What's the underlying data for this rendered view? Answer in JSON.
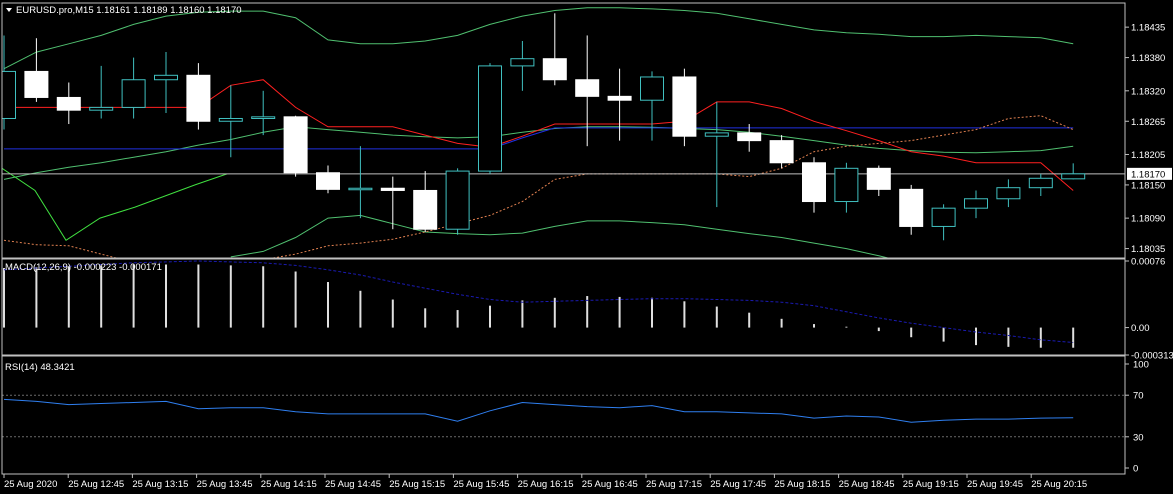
{
  "header": {
    "symbol_line": "EURUSD.pro,M15  1.18161 1.18189 1.18160 1.18170",
    "macd_label": "MACD(12,26,9) -0.000223 -0.000171",
    "rsi_label": "RSI(14) 48.3421"
  },
  "colors": {
    "background": "#000000",
    "frame": "#c0c0c0",
    "bull_body": "#000000",
    "bull_border": "#40c0c0",
    "bear_body": "#ffffff",
    "bear_border": "#ffffff",
    "bollinger": "#50c070",
    "envelope_lime": "#40e040",
    "tenkan_red": "#ff2020",
    "kijun_blue": "#2030e0",
    "chikou_dotted": "#e08050",
    "macd_hist": "#e0e0e0",
    "macd_signal": "#1a1ab0",
    "rsi_line": "#2f7ff0",
    "grid": "#6a6a6a",
    "price_marker_line": "#c0c0c0"
  },
  "chart_data": [
    {
      "type": "candlestick",
      "title": "EURUSD.pro,M15",
      "ylim": [
        1.18018,
        1.18475
      ],
      "y_ticks": [
        "1.18435",
        "1.18380",
        "1.18320",
        "1.18265",
        "1.18205",
        "1.18150",
        "1.18090",
        "1.18035"
      ],
      "current_price": "1.18170",
      "candles": [
        {
          "o": 1.1827,
          "h": 1.1842,
          "l": 1.1825,
          "c": 1.18355
        },
        {
          "o": 1.18355,
          "h": 1.18415,
          "l": 1.183,
          "c": 1.18308
        },
        {
          "o": 1.18308,
          "h": 1.18335,
          "l": 1.1826,
          "c": 1.18285
        },
        {
          "o": 1.18285,
          "h": 1.18365,
          "l": 1.1827,
          "c": 1.1829
        },
        {
          "o": 1.1829,
          "h": 1.1838,
          "l": 1.1827,
          "c": 1.1834
        },
        {
          "o": 1.1834,
          "h": 1.1839,
          "l": 1.1828,
          "c": 1.18348
        },
        {
          "o": 1.18348,
          "h": 1.1837,
          "l": 1.1825,
          "c": 1.18265
        },
        {
          "o": 1.18265,
          "h": 1.1833,
          "l": 1.182,
          "c": 1.1827
        },
        {
          "o": 1.1827,
          "h": 1.1832,
          "l": 1.1824,
          "c": 1.18273
        },
        {
          "o": 1.18273,
          "h": 1.18275,
          "l": 1.18165,
          "c": 1.18172
        },
        {
          "o": 1.18172,
          "h": 1.18185,
          "l": 1.18135,
          "c": 1.18142
        },
        {
          "o": 1.18142,
          "h": 1.1822,
          "l": 1.1809,
          "c": 1.18144
        },
        {
          "o": 1.18144,
          "h": 1.18165,
          "l": 1.1807,
          "c": 1.1814
        },
        {
          "o": 1.1814,
          "h": 1.18175,
          "l": 1.18065,
          "c": 1.1807
        },
        {
          "o": 1.1807,
          "h": 1.1818,
          "l": 1.1806,
          "c": 1.18175
        },
        {
          "o": 1.18175,
          "h": 1.1837,
          "l": 1.1817,
          "c": 1.18365
        },
        {
          "o": 1.18365,
          "h": 1.1841,
          "l": 1.1832,
          "c": 1.18378
        },
        {
          "o": 1.18378,
          "h": 1.1846,
          "l": 1.1833,
          "c": 1.1834
        },
        {
          "o": 1.1834,
          "h": 1.1842,
          "l": 1.1822,
          "c": 1.1831
        },
        {
          "o": 1.1831,
          "h": 1.1836,
          "l": 1.1823,
          "c": 1.18303
        },
        {
          "o": 1.18303,
          "h": 1.18355,
          "l": 1.1823,
          "c": 1.18345
        },
        {
          "o": 1.18345,
          "h": 1.1836,
          "l": 1.1822,
          "c": 1.18238
        },
        {
          "o": 1.18238,
          "h": 1.183,
          "l": 1.1811,
          "c": 1.18244
        },
        {
          "o": 1.18244,
          "h": 1.1826,
          "l": 1.1821,
          "c": 1.1823
        },
        {
          "o": 1.1823,
          "h": 1.1824,
          "l": 1.1818,
          "c": 1.1819
        },
        {
          "o": 1.1819,
          "h": 1.182,
          "l": 1.181,
          "c": 1.1812
        },
        {
          "o": 1.1812,
          "h": 1.1819,
          "l": 1.181,
          "c": 1.1818
        },
        {
          "o": 1.1818,
          "h": 1.18185,
          "l": 1.1813,
          "c": 1.18142
        },
        {
          "o": 1.18142,
          "h": 1.1815,
          "l": 1.1806,
          "c": 1.18075
        },
        {
          "o": 1.18075,
          "h": 1.18115,
          "l": 1.1805,
          "c": 1.18108
        },
        {
          "o": 1.18108,
          "h": 1.1814,
          "l": 1.1809,
          "c": 1.18125
        },
        {
          "o": 1.18125,
          "h": 1.1816,
          "l": 1.1811,
          "c": 1.18145
        },
        {
          "o": 1.18145,
          "h": 1.1817,
          "l": 1.1813,
          "c": 1.18162
        },
        {
          "o": 1.18161,
          "h": 1.18189,
          "l": 1.1816,
          "c": 1.1817
        }
      ],
      "overlays": {
        "bollinger_upper": [
          1.1836,
          1.1839,
          1.18405,
          1.1842,
          1.1844,
          1.18455,
          1.18462,
          1.18464,
          1.18464,
          1.18452,
          1.18412,
          1.18405,
          1.18405,
          1.1841,
          1.1842,
          1.1844,
          1.18455,
          1.18465,
          1.1847,
          1.1847,
          1.18468,
          1.18465,
          1.1846,
          1.1845,
          1.1844,
          1.1843,
          1.18425,
          1.18422,
          1.18418,
          1.18418,
          1.1842,
          1.18418,
          1.18416,
          1.18405
        ],
        "bollinger_middle": [
          1.1816,
          1.18172,
          1.18182,
          1.1819,
          1.182,
          1.1821,
          1.18222,
          1.18232,
          1.18245,
          1.18255,
          1.1825,
          1.18245,
          1.1824,
          1.18237,
          1.18235,
          1.18237,
          1.18245,
          1.18252,
          1.18255,
          1.18255,
          1.18254,
          1.18252,
          1.1825,
          1.18245,
          1.18238,
          1.1823,
          1.18222,
          1.18216,
          1.18212,
          1.18209,
          1.18208,
          1.1821,
          1.18212,
          1.1822
        ],
        "bollinger_lower": [
          null,
          null,
          null,
          null,
          null,
          null,
          null,
          1.1802,
          1.1803,
          1.18055,
          1.1809,
          1.18095,
          1.1808,
          1.18065,
          1.18062,
          1.1806,
          1.18063,
          1.18075,
          1.18085,
          1.18085,
          1.18082,
          1.18078,
          1.1807,
          1.18062,
          1.18055,
          1.18045,
          1.18035,
          1.18022,
          1.18008,
          null,
          null,
          null,
          null,
          null
        ],
        "envelope_lime": [
          1.1818,
          1.1814,
          1.1805,
          1.1809,
          1.1811,
          1.1813,
          1.1815,
          1.1817
        ],
        "tenkan_red": [
          1.1829,
          1.1829,
          1.1829,
          1.1829,
          1.1829,
          1.1829,
          1.1829,
          1.1833,
          1.1834,
          1.1829,
          1.18255,
          1.18255,
          1.18255,
          1.1824,
          1.18225,
          1.18218,
          1.18238,
          1.1826,
          1.1826,
          1.1826,
          1.1826,
          1.18265,
          1.183,
          1.183,
          1.18288,
          1.18265,
          1.18248,
          1.1823,
          1.1821,
          1.18202,
          1.1819,
          1.1819,
          1.1819,
          1.1814
        ],
        "kijun_blue": [
          1.18215,
          1.18215,
          1.18215,
          1.18215,
          1.18215,
          1.18215,
          1.18215,
          1.18215,
          1.18215,
          1.18215,
          1.18215,
          1.18215,
          1.18215,
          1.18215,
          1.18215,
          1.18215,
          1.18235,
          1.18253,
          1.18253,
          1.18253,
          1.18253,
          1.18253,
          1.18253,
          1.18253,
          1.18253,
          1.18253,
          1.18253,
          1.18253,
          1.18253,
          1.18253,
          1.18253,
          1.18253,
          1.18253,
          1.18253
        ],
        "chikou_dotted": [
          1.1805,
          1.18042,
          1.1804,
          1.18025,
          1.1801,
          1.18005,
          1.1801,
          1.18015,
          1.18015,
          1.18025,
          1.1804,
          1.18045,
          1.18052,
          1.18065,
          1.1808,
          1.18095,
          1.1812,
          1.1816,
          1.1817,
          1.1817,
          1.1817,
          1.1817,
          1.1817,
          1.18165,
          1.1818,
          1.1821,
          1.1822,
          1.18225,
          1.1823,
          1.1824,
          1.1825,
          1.1827,
          1.18275,
          1.1825
        ]
      }
    },
    {
      "type": "bar",
      "title": "MACD(12,26,9)",
      "ylim": [
        -0.000313,
        0.00076
      ],
      "y_ticks": [
        "0.00076",
        "0.00",
        "-0.000313"
      ],
      "histogram": [
        0.00068,
        0.00069,
        0.0007,
        0.00071,
        0.00072,
        0.00072,
        0.00072,
        0.00071,
        0.0007,
        0.00064,
        0.00052,
        0.00042,
        0.00032,
        0.00022,
        0.0002,
        0.00025,
        0.00031,
        0.00034,
        0.00036,
        0.00035,
        0.00034,
        0.0003,
        0.00024,
        0.00017,
        0.0001,
        4e-05,
        1e-05,
        -4e-05,
        -0.00011,
        -0.00016,
        -0.0002,
        -0.00022,
        -0.00023,
        -0.00023
      ],
      "signal": [
        0.00066,
        0.00068,
        0.0007,
        0.00072,
        0.00074,
        0.00075,
        0.00076,
        0.00075,
        0.00074,
        0.00071,
        0.00066,
        0.0006,
        0.00052,
        0.00045,
        0.00038,
        0.00032,
        0.00029,
        0.0003,
        0.00031,
        0.00032,
        0.00033,
        0.00033,
        0.00032,
        0.00031,
        0.00029,
        0.00025,
        0.00018,
        0.00011,
        5e-05,
        0.0,
        -5e-05,
        -9e-05,
        -0.00014,
        -0.00017
      ]
    },
    {
      "type": "line",
      "title": "RSI(14)",
      "ylim": [
        0,
        100
      ],
      "y_ticks": [
        "100",
        "70",
        "30",
        "0"
      ],
      "grid_levels": [
        70,
        30
      ],
      "values": [
        66,
        64,
        61,
        62,
        63,
        64,
        57,
        58,
        58,
        54,
        52,
        52,
        52,
        52,
        45,
        55,
        63,
        61,
        59,
        58,
        60,
        54,
        54,
        53,
        52,
        48,
        50,
        49,
        44,
        46,
        47,
        47,
        48,
        48.3
      ],
      "x_labels": [
        "25 Aug 2020",
        "25 Aug 12:45",
        "25 Aug 13:15",
        "25 Aug 13:45",
        "25 Aug 14:15",
        "25 Aug 14:45",
        "25 Aug 15:15",
        "25 Aug 15:45",
        "25 Aug 16:15",
        "25 Aug 16:45",
        "25 Aug 17:15",
        "25 Aug 17:45",
        "25 Aug 18:15",
        "25 Aug 18:45",
        "25 Aug 19:15",
        "25 Aug 19:45",
        "25 Aug 20:15"
      ]
    }
  ]
}
